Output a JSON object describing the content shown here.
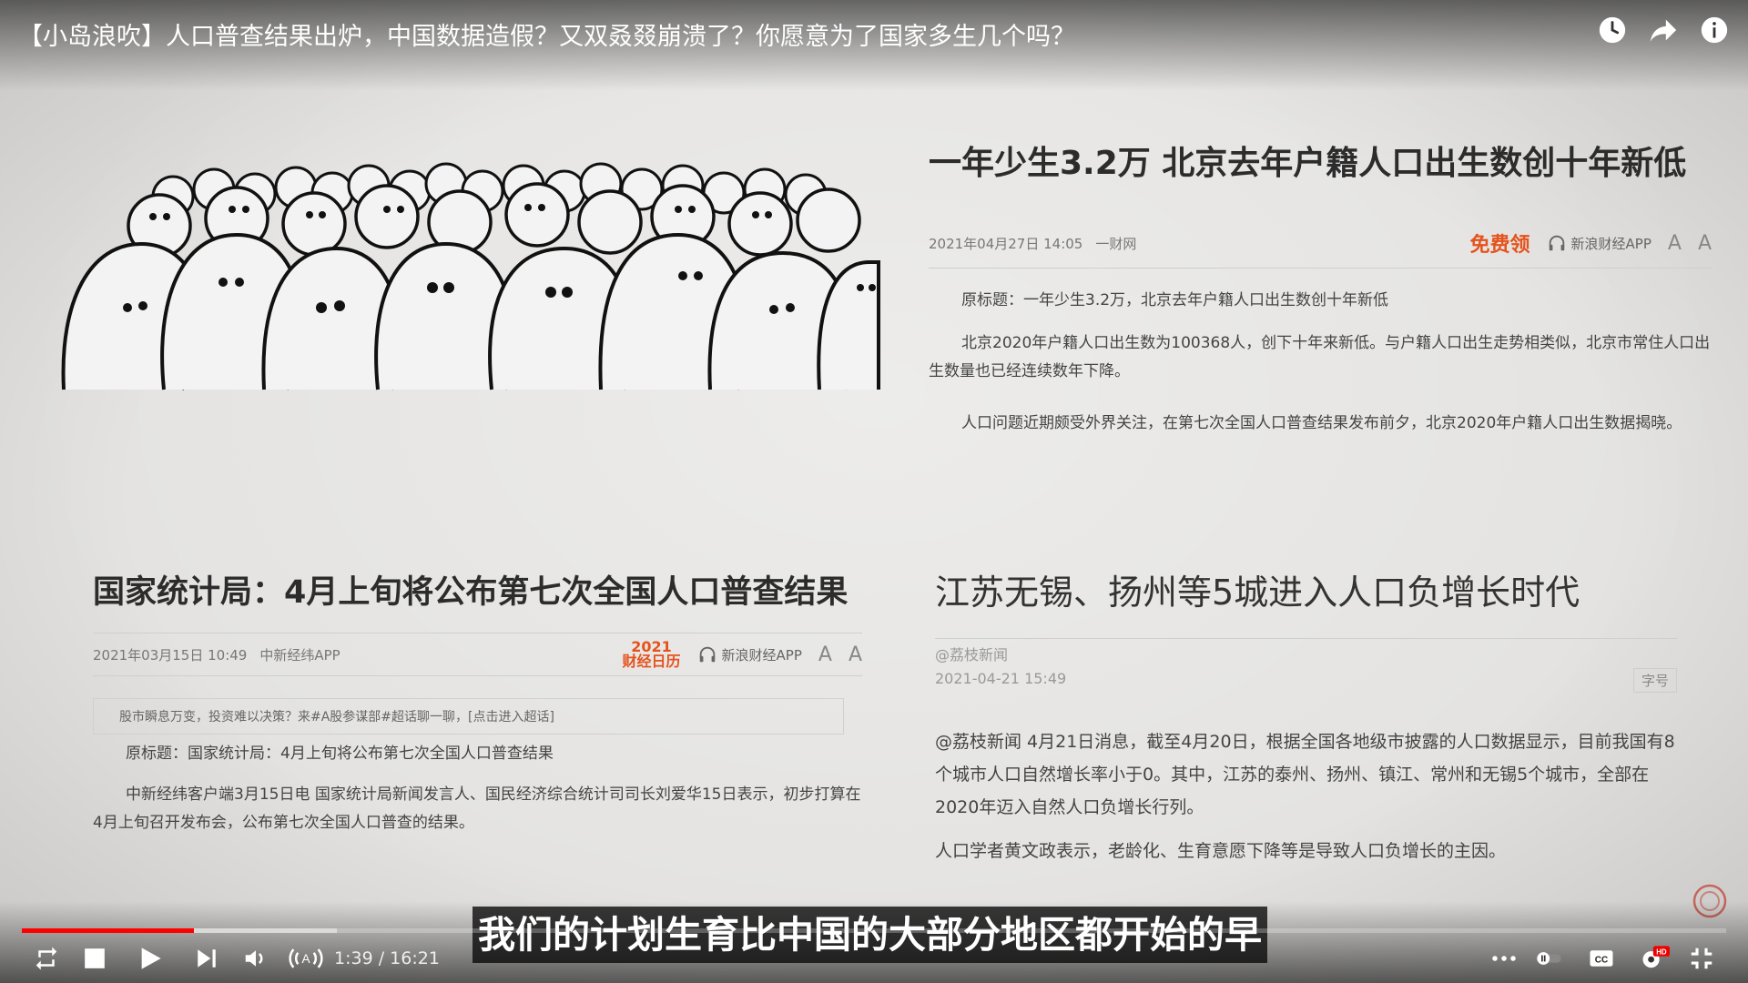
{
  "player": {
    "title": "【小岛浪吹】人口普查结果出炉，中国数据造假？又双叒叕崩溃了？你愿意为了国家多生几个吗？",
    "time_current": "1:39",
    "time_sep": " / ",
    "time_total": "16:21",
    "progress": 0.101,
    "buffered": 0.185,
    "subtitle": "我们的计划生育比中国的大部分地区都开始的早",
    "hd_badge": "HD",
    "colors": {
      "progress": "#ff0000",
      "accent": "#e5521c"
    },
    "icons": [
      "watch-later-icon",
      "share-icon",
      "info-icon",
      "loop-icon",
      "stop-icon",
      "play-icon",
      "next-icon",
      "volume-icon",
      "audio-description-icon",
      "more-icon",
      "autoplay-toggle",
      "captions-icon",
      "settings-icon",
      "fullscreen-exit-icon"
    ]
  },
  "article1": {
    "title": "一年少生3.2万 北京去年户籍人口出生数创十年新低",
    "date": "2021年04月27日 14:05",
    "source": "一财网",
    "free_badge": "免费领",
    "app_link": "新浪财经APP",
    "font_small": "A",
    "font_large": "A",
    "para1": "原标题：一年少生3.2万，北京去年户籍人口出生数创十年新低",
    "para2": "北京2020年户籍人口出生数为100368人，创下十年来新低。与户籍人口出生走势相类似，北京市常住人口出生数量也已经连续数年下降。",
    "para3": "人口问题近期颇受外界关注，在第七次全国人口普查结果发布前夕，北京2020年户籍人口出生数据揭晓。"
  },
  "article2": {
    "title": "国家统计局：4月上旬将公布第七次全国人口普查结果",
    "date": "2021年03月15日 10:49",
    "source": "中新经纬APP",
    "calendar_badge_year": "2021",
    "calendar_badge_text": "财经日历",
    "app_link": "新浪财经APP",
    "promo": "股市瞬息万变，投资难以决策？来#A股参谋部#超话聊一聊，[点击进入超话]",
    "para1": "原标题：国家统计局：4月上旬将公布第七次全国人口普查结果",
    "para2": "中新经纬客户端3月15日电 国家统计局新闻发言人、国民经济综合统计司司长刘爱华15日表示，初步打算在4月上旬召开发布会，公布第七次全国人口普查的结果。"
  },
  "article3": {
    "title": "江苏无锡、扬州等5城进入人口负增长时代",
    "author": "@荔枝新闻",
    "date": "2021-04-21 15:49",
    "font_btn": "字号",
    "para1": "@荔枝新闻 4月21日消息，截至4月20日，根据全国各地级市披露的人口数据显示，目前我国有8个城市人口自然增长率小于0。其中，江苏的泰州、扬州、镇江、常州和无锡5个城市，全部在2020年迈入自然人口负增长行列。",
    "para2": "人口学者黄文政表示，老龄化、生育意愿下降等是导致人口负增长的主因。"
  }
}
